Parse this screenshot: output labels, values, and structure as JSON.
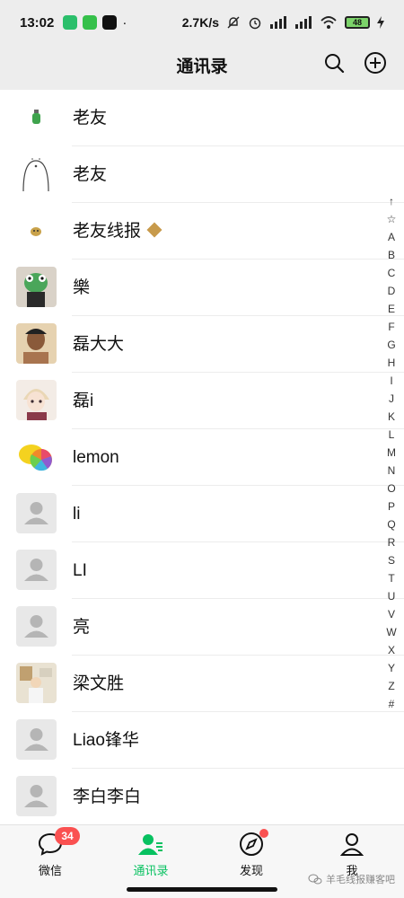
{
  "status_bar": {
    "time": "13:02",
    "net_speed": "2.7K/s",
    "battery": "48",
    "dot": "·"
  },
  "header": {
    "title": "通讯录",
    "search_icon": "search-icon",
    "add_icon": "add-circle-icon"
  },
  "contacts": [
    {
      "name": "老友",
      "avatar": "bottle-icon"
    },
    {
      "name": "老友",
      "avatar": "sketch-face-icon"
    },
    {
      "name": "老友线报",
      "avatar": "small-sticker-icon",
      "badge": "福"
    },
    {
      "name": "樂",
      "avatar": "frog-avatar"
    },
    {
      "name": "磊大大",
      "avatar": "portrait-photo"
    },
    {
      "name": "磊i",
      "avatar": "anime-avatar"
    },
    {
      "name": "lemon",
      "avatar": "lemon-avatar"
    },
    {
      "name": "li",
      "avatar": "default-avatar"
    },
    {
      "name": "LI",
      "avatar": "default-avatar"
    },
    {
      "name": "亮",
      "avatar": "default-avatar"
    },
    {
      "name": "梁文胜",
      "avatar": "room-photo"
    },
    {
      "name": "Liao锋华",
      "avatar": "default-avatar"
    },
    {
      "name": "李白李白",
      "avatar": "default-avatar"
    }
  ],
  "index_bar": [
    "↑",
    "☆",
    "A",
    "B",
    "C",
    "D",
    "E",
    "F",
    "G",
    "H",
    "I",
    "J",
    "K",
    "L",
    "M",
    "N",
    "O",
    "P",
    "Q",
    "R",
    "S",
    "T",
    "U",
    "V",
    "W",
    "X",
    "Y",
    "Z",
    "#"
  ],
  "tabs": [
    {
      "label": "微信",
      "icon": "chat-bubble-icon",
      "badge": "34"
    },
    {
      "label": "通讯录",
      "icon": "contacts-icon",
      "active": true
    },
    {
      "label": "发现",
      "icon": "compass-icon",
      "dot": true
    },
    {
      "label": "我",
      "icon": "person-icon"
    }
  ],
  "watermark": "羊毛线报赚客吧",
  "colors": {
    "accent": "#07c160",
    "badge": "#fa5151",
    "background": "#ededed"
  }
}
